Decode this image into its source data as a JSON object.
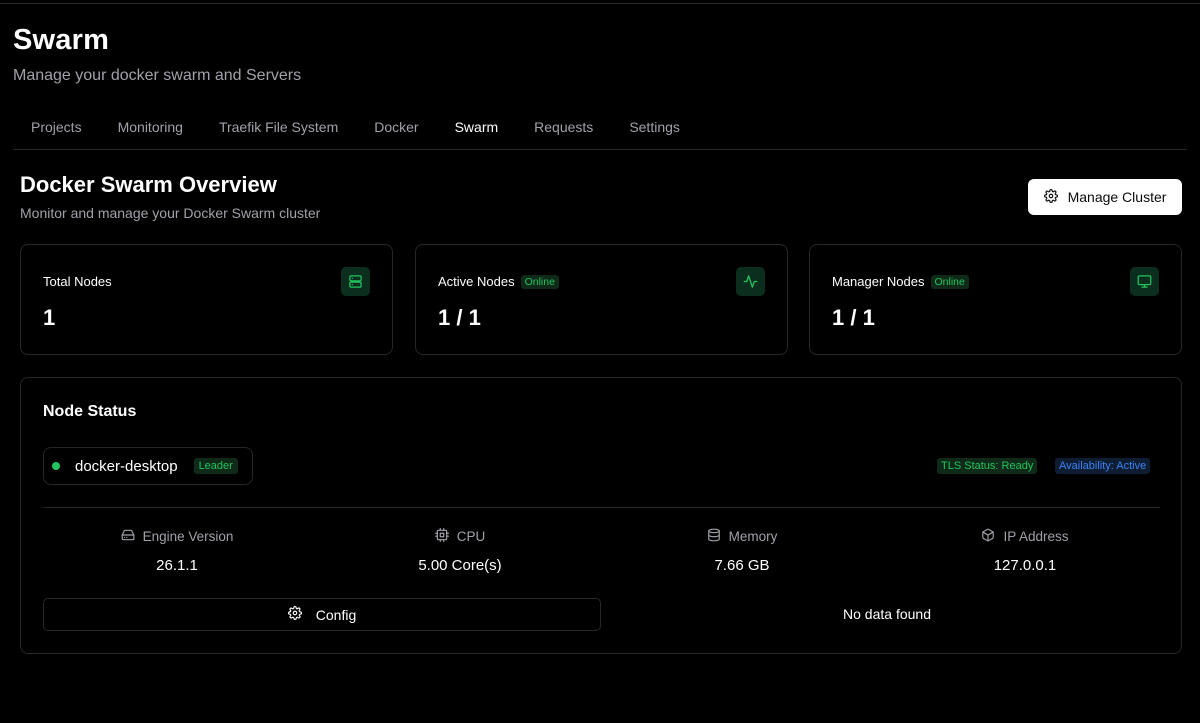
{
  "page": {
    "title": "Swarm",
    "subtitle": "Manage your docker swarm and Servers"
  },
  "tabs": [
    {
      "label": "Projects"
    },
    {
      "label": "Monitoring"
    },
    {
      "label": "Traefik File System"
    },
    {
      "label": "Docker"
    },
    {
      "label": "Swarm",
      "active": true
    },
    {
      "label": "Requests"
    },
    {
      "label": "Settings"
    }
  ],
  "overview": {
    "title": "Docker Swarm Overview",
    "subtitle": "Monitor and manage your Docker Swarm cluster",
    "manage_button": "Manage Cluster"
  },
  "stats": {
    "total": {
      "label": "Total Nodes",
      "value": "1",
      "icon": "server-icon"
    },
    "active": {
      "label": "Active Nodes",
      "badge": "Online",
      "value": "1 / 1",
      "icon": "activity-icon"
    },
    "manager": {
      "label": "Manager Nodes",
      "badge": "Online",
      "value": "1 / 1",
      "icon": "monitor-icon"
    }
  },
  "node_status": {
    "title": "Node Status",
    "node_name": "docker-desktop",
    "role_badge": "Leader",
    "tls_badge": "TLS Status: Ready",
    "availability_badge": "Availability: Active",
    "metrics": {
      "engine": {
        "label": "Engine Version",
        "value": "26.1.1",
        "icon": "hard-drive-icon"
      },
      "cpu": {
        "label": "CPU",
        "value": "5.00 Core(s)",
        "icon": "cpu-icon"
      },
      "memory": {
        "label": "Memory",
        "value": "7.66 GB",
        "icon": "database-icon"
      },
      "ip": {
        "label": "IP Address",
        "value": "127.0.0.1",
        "icon": "box-icon"
      }
    },
    "config_button": "Config",
    "no_data": "No data found"
  },
  "colors": {
    "background": "#000000",
    "border": "#27272a",
    "muted_text": "#a1a1aa",
    "success": "#22c55e",
    "info": "#3b82f6"
  }
}
